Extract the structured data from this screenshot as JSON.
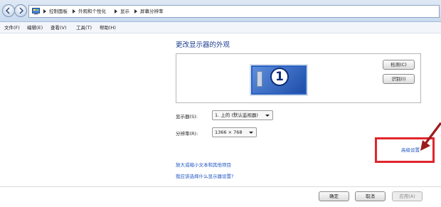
{
  "address_bar": {
    "icon": "control-panel-icon",
    "crumbs": [
      "控制面板",
      "外观和个性化",
      "显示",
      "屏幕分辨率"
    ]
  },
  "menu": {
    "items": [
      "文件(F)",
      "编辑(E)",
      "查看(V)",
      "工具(T)",
      "帮助(H)"
    ]
  },
  "content": {
    "title": "更改显示器的外观",
    "monitor_number": "1",
    "detect_button": "检测(C)",
    "identify_button": "识别(I)",
    "display_label": "显示器(S):",
    "display_value": "1. 上的 (默认监视器)",
    "resolution_label": "分辨率(R):",
    "resolution_value": "1366 × 768",
    "advanced_link": "高级设置",
    "link_1": "放大或缩小文本和其他项目",
    "link_2": "我应该选择什么显示器设置?"
  },
  "footer": {
    "ok": "确定",
    "cancel": "取消",
    "apply": "应用(A)"
  },
  "colors": {
    "title_blue": "#1e3f8f",
    "link_blue": "#1f55c0",
    "highlight_red": "#e0262c",
    "annotation_arrow": "#9b1c1c"
  }
}
